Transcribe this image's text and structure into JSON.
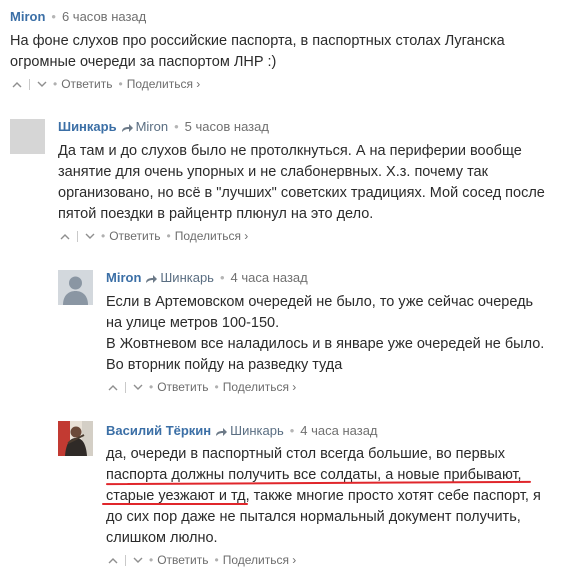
{
  "comments": [
    {
      "author": "Miron",
      "reply_to": "",
      "time": "6 часов назад",
      "lines": [
        "На фоне слухов про российские паспорта, в паспортных столах Луганска",
        "огромные очереди за паспортом ЛНР :)"
      ],
      "reply_label": "Ответить",
      "share_label": "Поделиться ›"
    },
    {
      "author": "Шинкарь",
      "reply_to": "Miron",
      "time": "5 часов назад",
      "lines": [
        "Да там и до слухов было не протолкнуться. А на периферии вообще",
        "занятие для очень упорных и не слабонервных. Х.з. почему так",
        "организовано, но всё в \"лучших\" советских традициях. Мой сосед после",
        "пятой поездки в райцентр плюнул на это дело."
      ],
      "reply_label": "Ответить",
      "share_label": "Поделиться ›"
    },
    {
      "author": "Miron",
      "reply_to": "Шинкарь",
      "time": "4 часа назад",
      "lines": [
        "Если в Артемовском очередей не было, то уже сейчас очередь",
        "на улице метров 100-150.",
        "В Жовтневом все наладилось и в январе уже очередей не было.",
        "Во вторник пойду на разведку туда"
      ],
      "reply_label": "Ответить",
      "share_label": "Поделиться ›"
    },
    {
      "author": "Василий Тёркин",
      "reply_to": "Шинкарь",
      "time": "4 часа назад",
      "lines": [
        "да, очереди в паспортный стол всегда большие, во первых",
        "паспорта должны получить все солдаты, а новые прибывают,",
        "старые уезжают и тд, также многие просто хотят себе паспорт, я",
        "до сих пор даже не пытался нормальный документ получить,",
        "слишком люлно."
      ],
      "reply_label": "Ответить",
      "share_label": "Поделиться ›"
    }
  ],
  "colors": {
    "author": "#3b6fa6",
    "highlight_underline": "#e0262b"
  },
  "icons": {
    "upvote": "chevron-up-icon",
    "downvote": "chevron-down-icon",
    "reply_arrow": "reply-arrow-icon",
    "avatar_default": "user-silhouette-icon"
  }
}
